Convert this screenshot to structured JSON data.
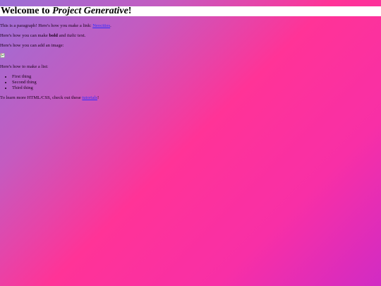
{
  "header": {
    "title_prefix": "Welcome to ",
    "title_emph": "Project Generative",
    "title_suffix": "!"
  },
  "para1": {
    "text": "This is a paragraph! Here's how you make a link: ",
    "link": "Neocities",
    "end": "."
  },
  "para2": {
    "text": "Here's how you can make ",
    "bold": "bold",
    "mid": " and ",
    "italic": "italic",
    "end": " text."
  },
  "para3": {
    "text": "Here's how you can add an image:"
  },
  "para4": {
    "text": "Here's how to make a list:"
  },
  "list": [
    "First thing",
    "Second thing",
    "Third thing"
  ],
  "para5": {
    "text": "To learn more HTML/CSS, check out these ",
    "link": "tutorials",
    "end": "!"
  },
  "image": {
    "icon": "broken-image-icon"
  },
  "colors": {
    "gradient_start": "#9b6fd6",
    "gradient_mid": "#ff3397",
    "gradient_end": "#d12bc4",
    "link": "#2a2aff",
    "header_bg": "#ffffff"
  }
}
